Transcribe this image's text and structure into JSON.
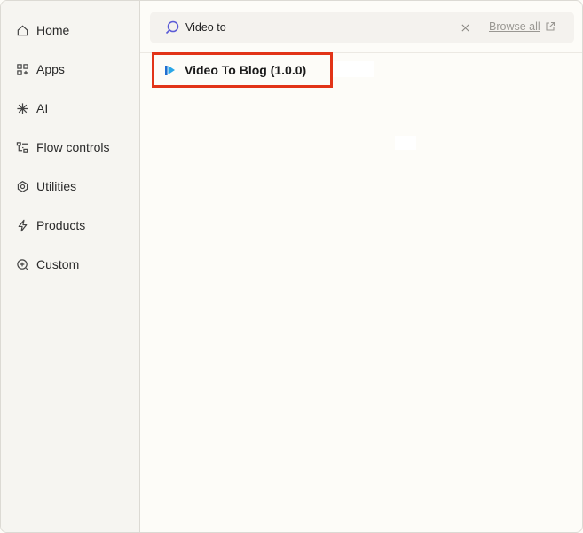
{
  "sidebar": {
    "items": [
      {
        "label": "Home",
        "icon": "home-icon"
      },
      {
        "label": "Apps",
        "icon": "apps-icon"
      },
      {
        "label": "AI",
        "icon": "ai-sparkle-icon"
      },
      {
        "label": "Flow controls",
        "icon": "flow-controls-icon"
      },
      {
        "label": "Utilities",
        "icon": "utilities-gear-icon"
      },
      {
        "label": "Products",
        "icon": "lightning-icon"
      },
      {
        "label": "Custom",
        "icon": "custom-plus-icon"
      }
    ]
  },
  "search": {
    "value": "Video to",
    "browse_all_label": "Browse all",
    "accent_color": "#5b5bd6"
  },
  "results": [
    {
      "label": "Video To Blog (1.0.0)",
      "icon": "video-to-blog-app-icon",
      "highlight_color": "#e23418"
    }
  ]
}
